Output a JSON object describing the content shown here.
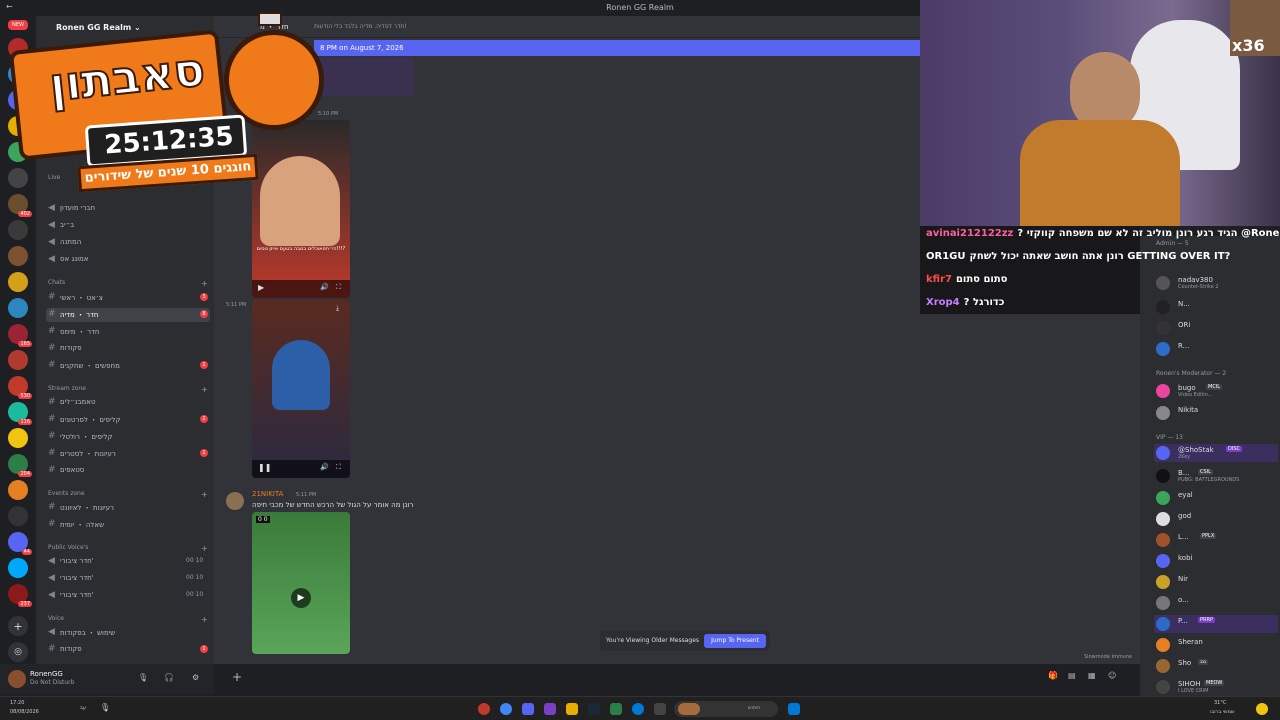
{
  "window": {
    "title": "Ronen GG Realm"
  },
  "server": {
    "name": "Ronen GG Realm"
  },
  "rail": {
    "new_label": "NEW",
    "badges": [
      "402",
      "165",
      "530",
      "116",
      "204",
      "44",
      "237"
    ]
  },
  "sidebar": {
    "live_label": "Live",
    "live_channels": [
      {
        "name": "חברי מועדון"
      },
      {
        "name": "ב״יב"
      },
      {
        "name": "המתנה"
      },
      {
        "name": "אמונג אס"
      }
    ],
    "chats_label": "Chats",
    "chats_channels": [
      {
        "name": "צ׳אט ・ ראשי",
        "unread": "3"
      },
      {
        "name": "חדר ・ מדיה",
        "unread": "8",
        "active": true
      },
      {
        "name": "חדר ・ מימס"
      },
      {
        "name": "פקודות"
      },
      {
        "name": "מחפשים ・ שחקנים",
        "unread": "1"
      }
    ],
    "stream_label": "Stream zone",
    "stream_channels": [
      {
        "name": "טאמבנ״לים"
      },
      {
        "name": "קליפים ・ לסרטונים",
        "unread": "2"
      },
      {
        "name": "קליפים ・ רולטלי"
      },
      {
        "name": "רעיונות ・ לסטרים",
        "unread": "1"
      },
      {
        "name": "סטאפים"
      }
    ],
    "events_label": "Events zone",
    "events_channels": [
      {
        "name": "רעיונות ・ לאיוונט"
      },
      {
        "name": "שאלה ・ יומית"
      }
    ],
    "public_voice_label": "Public Voice's",
    "public_voice_channels": [
      {
        "name": "חדר ציבורי'",
        "count": "00  10"
      },
      {
        "name": "חדר ציבורי'",
        "count": "00  10"
      },
      {
        "name": "חדר ציבורי'",
        "count": "00  10"
      }
    ],
    "voice_label": "Voice",
    "voice_channels": [
      {
        "name": "שימוש ・ בפקודות"
      },
      {
        "name": "פקודות",
        "unread": "1"
      }
    ]
  },
  "user": {
    "name": "RonenGG",
    "status": "Do Not Disturb"
  },
  "chat": {
    "channel_name": "חדר ・ מ",
    "topic": "חדר לפדיה. מדיה בלבד בלי הודעות!",
    "new_banner": "8 PM on August 7, 2026",
    "ts1": "5:10 PM",
    "ts2": "5:11 PM",
    "msg_author": "21NIKITA",
    "msg_time": "5:11 PM",
    "msg_text": "רונן מה אומר על הגול של הרכש החדש של מכבי חיפה",
    "media_caption": "הי״תפאוכלים במבה בטעם אייזן נוסים!!!?",
    "score": "0 0",
    "older_text": "You're Viewing Older Messages",
    "jump_label": "Jump To Present",
    "slowmode": "Slowmode Immune"
  },
  "promo": {
    "title": "סאבתון",
    "timer": "25:12:35",
    "subtitle": "חוגגים 10 שנים של שידורים"
  },
  "cam": {
    "multiplier": "x36"
  },
  "stream_chat": [
    {
      "name": "avinai212122zz",
      "text": "? הגיד רגע רונן מוליב זה לא שם משפחה קווקזי @Roner",
      "color": "#ff5fa2"
    },
    {
      "name": "OR1GU",
      "text": "רונן אתה חושב שאתה יכול לשחק GETTING OVER IT?",
      "color": "#ffffff"
    },
    {
      "name": "kfir7",
      "text": "סתום סתום",
      "color": "#ff4b4b"
    },
    {
      "name": "Xrop4",
      "text": "? כדורגל",
      "color": "#c77dff"
    }
  ],
  "members": {
    "admin_label": "Admin — 5",
    "admins": [
      {
        "name": "nadav380",
        "status": "Counter-Strike 2",
        "color": "#eb459e"
      },
      {
        "name": "N...",
        "color": "#f2f3f5"
      },
      {
        "name": "ORi",
        "color": "#f23f43"
      },
      {
        "name": "R...",
        "color": "#f23f43"
      }
    ],
    "mod_label": "Ronen's Moderator — 2",
    "mods": [
      {
        "name": "bugo",
        "status": "Video Editin...",
        "tag": "MCIL",
        "color": "#eb459e"
      },
      {
        "name": "Nikita",
        "color": "#eb459e"
      }
    ],
    "vip_label": "VIP — 13",
    "vips": [
      {
        "name": "@ShoStak",
        "status": "2Key",
        "tag": "DISC",
        "color": "#5865f2"
      },
      {
        "name": "B...",
        "status": "PUBG: BATTLEGROUNDS",
        "tag": "CSIL",
        "color": "#f2f3f5"
      },
      {
        "name": "eyal",
        "color": "#f1c40f"
      },
      {
        "name": "god",
        "color": "#f1c40f"
      },
      {
        "name": "L...",
        "tag": "PPLX",
        "color": "#f1c40f"
      },
      {
        "name": "kobi",
        "color": "#f1c40f"
      },
      {
        "name": "Nir",
        "color": "#f1c40f"
      },
      {
        "name": "o...",
        "color": "#f1c40f"
      },
      {
        "name": "P...",
        "tag": "PRRP",
        "color": "#f1c40f"
      },
      {
        "name": "Sheran",
        "color": "#f1c40f"
      },
      {
        "name": "Sho",
        "tag": "נננ",
        "color": "#f1c40f"
      },
      {
        "name": "SIHOH",
        "status": "I LOVE CRIM",
        "tag": "MEOW",
        "color": "#f1c40f"
      }
    ]
  },
  "taskbar": {
    "clock": "17:20",
    "date": "08/08/2026",
    "search_placeholder": "חיפוש",
    "weather": "31°C",
    "weather_sub": "שמשי ברובו",
    "lang": "עב"
  },
  "colors": {
    "accent": "#5865f2",
    "sidebar": "#2b2d31",
    "chat": "#313338",
    "red": "#f23f43"
  }
}
